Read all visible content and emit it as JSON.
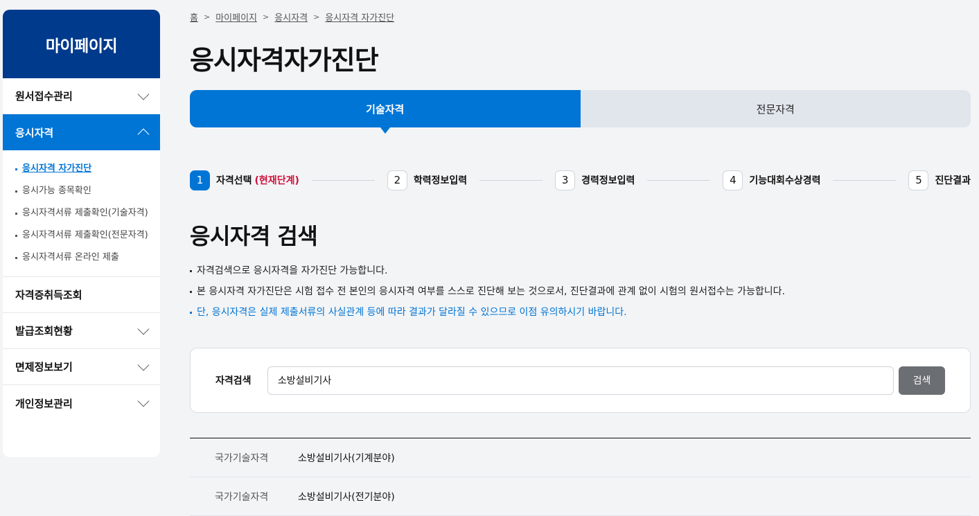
{
  "sidebar": {
    "title": "마이페이지",
    "menu": [
      {
        "label": "원서접수관리"
      },
      {
        "label": "응시자격"
      },
      {
        "label": "자격증취득조회"
      },
      {
        "label": "발급조회현황"
      },
      {
        "label": "면제정보보기"
      },
      {
        "label": "개인정보관리"
      }
    ],
    "submenu": [
      {
        "label": "응시자격 자가진단"
      },
      {
        "label": "응시가능 종목확인"
      },
      {
        "label": "응시자격서류 제출확인(기술자격)"
      },
      {
        "label": "응시자격서류 제출확인(전문자격)"
      },
      {
        "label": "응시자격서류 온라인 제출"
      }
    ]
  },
  "breadcrumb": [
    "홈",
    "마이페이지",
    "응시자격",
    "응시자격 자가진단"
  ],
  "page_title": "응시자격자가진단",
  "tabs": [
    {
      "label": "기술자격"
    },
    {
      "label": "전문자격"
    }
  ],
  "steps": [
    {
      "num": "1",
      "label": "자격선택",
      "current": "(현재단계)"
    },
    {
      "num": "2",
      "label": "학력정보입력"
    },
    {
      "num": "3",
      "label": "경력정보입력"
    },
    {
      "num": "4",
      "label": "기능대회수상경력"
    },
    {
      "num": "5",
      "label": "진단결과"
    }
  ],
  "section_title": "응시자격 검색",
  "notes": [
    "자격검색으로 응시자격을 자가진단 가능합니다.",
    "본 응시자격 자가진단은 시험 접수 전 본인의 응시자격 여부를 스스로 진단해 보는 것으로서, 진단결과에 관계 없이 시험의 원서접수는 가능합니다.",
    "단, 응시자격은 실제 제출서류의 사실관계 등에 따라 결과가 달라질 수 있으므로 이점 유의하시기 바랍니다."
  ],
  "search": {
    "label": "자격검색",
    "value": "소방설비기사",
    "button": "검색"
  },
  "results": [
    {
      "category": "국가기술자격",
      "name": "소방설비기사(기계분야)"
    },
    {
      "category": "국가기술자격",
      "name": "소방설비기사(전기분야)"
    }
  ],
  "colors": {
    "brand_dark": "#003a8c",
    "accent": "#0075d5",
    "current_step": "#d0103a"
  }
}
